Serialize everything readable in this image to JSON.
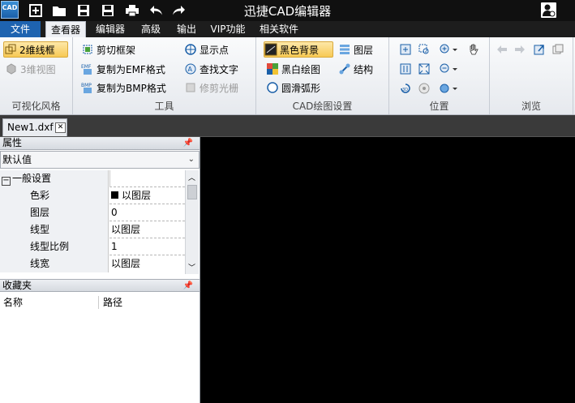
{
  "app": {
    "title": "迅捷CAD编辑器",
    "logo_text": "CAD"
  },
  "menu": {
    "tabs": [
      "文件",
      "查看器",
      "编辑器",
      "高级",
      "输出",
      "VIP功能",
      "相关软件"
    ],
    "active": "查看器"
  },
  "ribbon": {
    "visual_style": {
      "label": "可视化风格",
      "wire2d": "2维线框",
      "view3d": "3维视图"
    },
    "tools": {
      "label": "工具",
      "clip_frame": "剪切框架",
      "copy_emf": "复制为EMF格式",
      "copy_bmp": "复制为BMP格式",
      "show_points": "显示点",
      "find_text": "查找文字",
      "trim_raster": "修剪光栅"
    },
    "cad_settings": {
      "label": "CAD绘图设置",
      "black_bg": "黑色背景",
      "bw_drawing": "黑白绘图",
      "smooth_arc": "圆滑弧形",
      "layers": "图层",
      "structure": "结构"
    },
    "position": {
      "label": "位置"
    },
    "browse": {
      "label": "浏览"
    }
  },
  "doc": {
    "tab_name": "New1.dxf",
    "close_symbol": "✕"
  },
  "properties": {
    "header": "属性",
    "dropdown_value": "默认值",
    "section": "一般设置",
    "rows": [
      {
        "name": "色彩",
        "value": "以图层"
      },
      {
        "name": "图层",
        "value": "0"
      },
      {
        "name": "线型",
        "value": "以图层"
      },
      {
        "name": "线型比例",
        "value": "1"
      },
      {
        "name": "线宽",
        "value": "以图层"
      }
    ]
  },
  "favorites": {
    "header": "收藏夹",
    "col_name": "名称",
    "col_path": "路径"
  },
  "colors": {
    "file_tab": "#1e63b0",
    "selected_button": "#f7c955",
    "canvas": "#000000"
  }
}
